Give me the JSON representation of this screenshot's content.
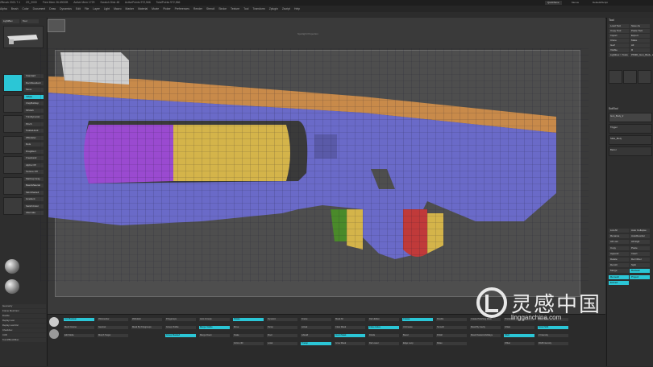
{
  "app": {
    "title": "ZBrush 2021.7.1",
    "title_extra": [
      "ZS_2000",
      "Free Mem 26.690GB",
      "Active Mem 1729",
      "Scratch Disk 48",
      "ActivePoints 972,566",
      "TotalPoints 972,566",
      "Quicksave"
    ],
    "quicksave_label": "QuickSave",
    "menu_label": "Menus",
    "script_label": "DefaultZScript"
  },
  "menubar": [
    "Alpha",
    "Brush",
    "Color",
    "Document",
    "Draw",
    "Dynamics",
    "Edit",
    "File",
    "Layer",
    "Light",
    "Macro",
    "Marker",
    "Material",
    "Movie",
    "Picker",
    "Preferences",
    "Render",
    "Stencil",
    "Stroke",
    "Texture",
    "Tool",
    "Transform",
    "Zplugin",
    "Zscript",
    "Help"
  ],
  "left_shelf": {
    "lightbox_label": "LightBox",
    "tool_label": "Tool",
    "items": [
      "Standard",
      "DamStandard",
      "Move",
      "Inflate",
      "ClayBuildup",
      "hPolish",
      "TrimDynamic",
      "Pinch",
      "SnakeHook",
      "ZModeler",
      "Dots",
      "DragRect",
      "FreeHand",
      "Alpha Off",
      "Texture Off",
      "MatCap Gray",
      "BasicMaterial",
      "SkinShade4",
      "Gradient",
      "SwitchColor",
      "Alternate"
    ]
  },
  "left_panel_bottom": [
    "Geometry",
    "Frame Mesh Ext",
    "Double",
    "Replay Last",
    "Replay Last Rel",
    "Checkbox",
    "CtrlF",
    "Tool:ZBrushMan"
  ],
  "right_panel": {
    "header": "Tool",
    "items": [
      "Load Tool",
      "Save As",
      "Copy Tool",
      "Paste Tool",
      "Import",
      "Export",
      "Clone",
      "Make PolyMesh3D",
      "GoZ",
      "All",
      "Visible",
      "R",
      "Lightbox > Tools",
      "PM3D_Gun_Body_2",
      "SubTool"
    ],
    "subtool_list": [
      "Gun_Body_2",
      "Trigger",
      "Slide_Body",
      "Barrel"
    ],
    "lower": [
      "List All",
      "Auto Collapse",
      "Rename",
      "AutoReorder",
      "All Low",
      "All High",
      "Copy",
      "Paste",
      "Append",
      "Insert",
      "Delete",
      "Del Other",
      "Del All",
      "Split",
      "Merge",
      "Boolean",
      "Remesh",
      "Project",
      "Extract"
    ]
  },
  "bottom_panels": {
    "col1": [
      "Live Boolean",
      "Mesh Interse",
      "Edit Mode"
    ],
    "col2": [
      "ZRemesher",
      "Geomet",
      "Morph Target"
    ],
    "col3": [
      "ZModeler",
      "Mask By Polygroups"
    ],
    "col4": [
      "Polygroups",
      "Group Visible",
      "Group Masked"
    ],
    "col5": [
      "Auto Groups",
      "Merge Visible",
      "Merge Down"
    ],
    "col6": [
      "Rotate",
      "Move",
      "Scale",
      "Gizmo 3D"
    ],
    "col7": [
      "Dynamic",
      "Persp",
      "Floor",
      "Local"
    ],
    "col8": [
      "Frame",
      "Actual",
      "AAHalf",
      "Transp"
    ],
    "col9": [
      "Mask All",
      "Clear Mask",
      "Invert Mask",
      "Grow Mask"
    ],
    "col10": [
      "Del Hidden",
      "Close Holes",
      "Divide",
      "Del Lower"
    ],
    "col11": [
      "Crease",
      "UnCrease",
      "Bevel",
      "Edge Loop"
    ],
    "col12": [
      "Double",
      "Smooth",
      "Polish",
      "Relax"
    ],
    "col13": [
      "Create Polishing Mask",
      "Mask By Cavity",
      "Mask PeaksAndValleys"
    ],
    "col14": [
      "Thickness",
      "Inflate",
      "Shell",
      "Offset"
    ],
    "col15": [
      "Draw Size",
      "Focal Shift",
      "Z Intensity",
      "RGB Intensity"
    ]
  },
  "canvas_hint": "Spotlight Projection",
  "colors": {
    "accent": "#2bc6d6",
    "mesh_blue": "#6a6ac8",
    "mesh_orange": "#c88a4a",
    "mesh_purple": "#9a4ad0",
    "mesh_yellow": "#d4b44a",
    "mesh_red": "#c03a3a",
    "mesh_green": "#4a8a2a"
  },
  "watermark": {
    "cn_text": "灵感中国",
    "url_text": "lingganchina.com"
  }
}
